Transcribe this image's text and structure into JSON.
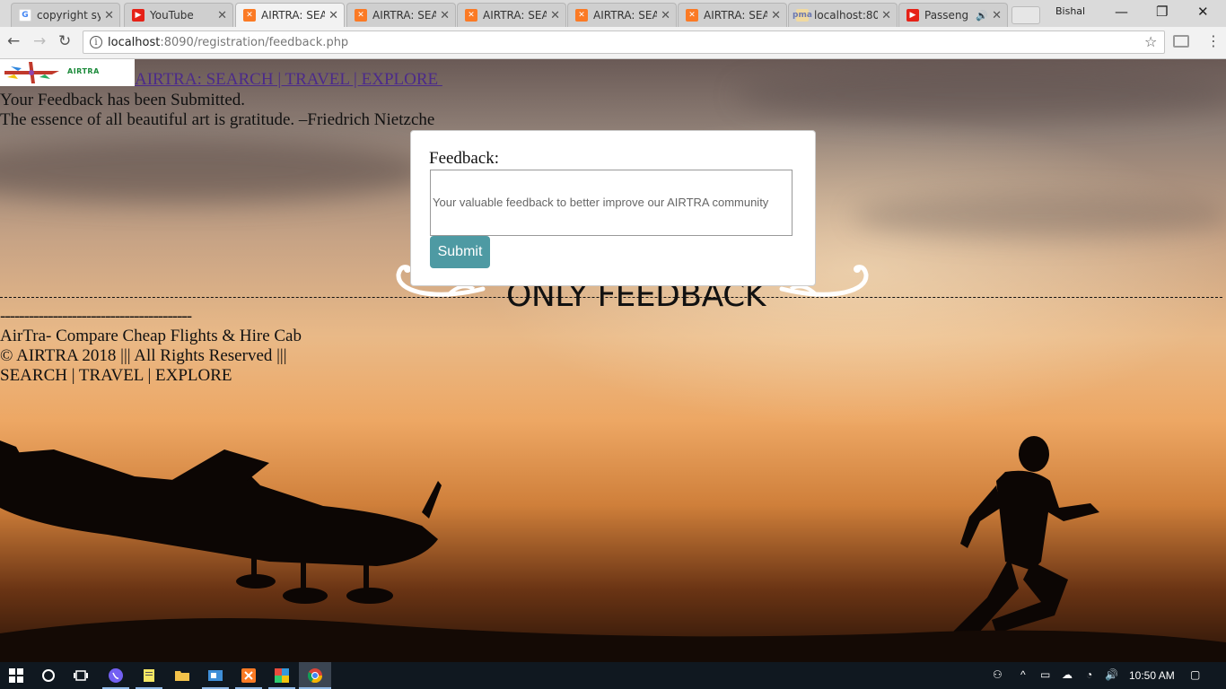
{
  "browser": {
    "tabs": [
      {
        "title": "copyright sy",
        "favicon": "google-icon",
        "active": false
      },
      {
        "title": "YouTube",
        "favicon": "youtube-icon",
        "active": false
      },
      {
        "title": "AIRTRA: SEA",
        "favicon": "xampp-icon",
        "active": true
      },
      {
        "title": "AIRTRA: SEA",
        "favicon": "xampp-icon",
        "active": false
      },
      {
        "title": "AIRTRA: SEA",
        "favicon": "xampp-icon",
        "active": false
      },
      {
        "title": "AIRTRA: SEA",
        "favicon": "xampp-icon",
        "active": false
      },
      {
        "title": "AIRTRA: SEA",
        "favicon": "xampp-icon",
        "active": false
      },
      {
        "title": "localhost:80",
        "favicon": "phpmyadmin-icon",
        "active": false
      },
      {
        "title": "Passeng",
        "favicon": "youtube-icon",
        "active": false,
        "audio": true
      }
    ],
    "profile_name": "Bishal",
    "url_host": "localhost",
    "url_rest": ":8090/registration/feedback.php"
  },
  "page": {
    "logo_text": "AIRTRA",
    "site_link": "AIRTRA: SEARCH | TRAVEL | EXPLORE ",
    "status_message": "Your Feedback has been Submitted.",
    "quote": "The essence of all beautiful art is gratitude. –Friedrich Nietzche",
    "form": {
      "label": "Feedback:",
      "placeholder": "Your valuable feedback to better improve our AIRTRA community",
      "submit_label": "Submit"
    },
    "heading": "ONLY FEEDBACK",
    "short_divider": "----------------------------------------",
    "footer": {
      "line1": "AirTra- Compare Cheap Flights & Hire Cab",
      "line2": "© AIRTRA 2018 ||| All Rights Reserved |||",
      "line3": "SEARCH | TRAVEL | EXPLORE"
    },
    "colors": {
      "submit": "#4e9aa3",
      "link": "#4b2a8a"
    }
  },
  "taskbar": {
    "clock": "10:50 AM",
    "pinned": [
      "windows-start-icon",
      "cortana-icon",
      "task-view-icon",
      "viber-icon",
      "notes-icon",
      "file-explorer-icon",
      "outlook-icon",
      "xampp-icon",
      "paint-icon",
      "chrome-icon"
    ]
  }
}
